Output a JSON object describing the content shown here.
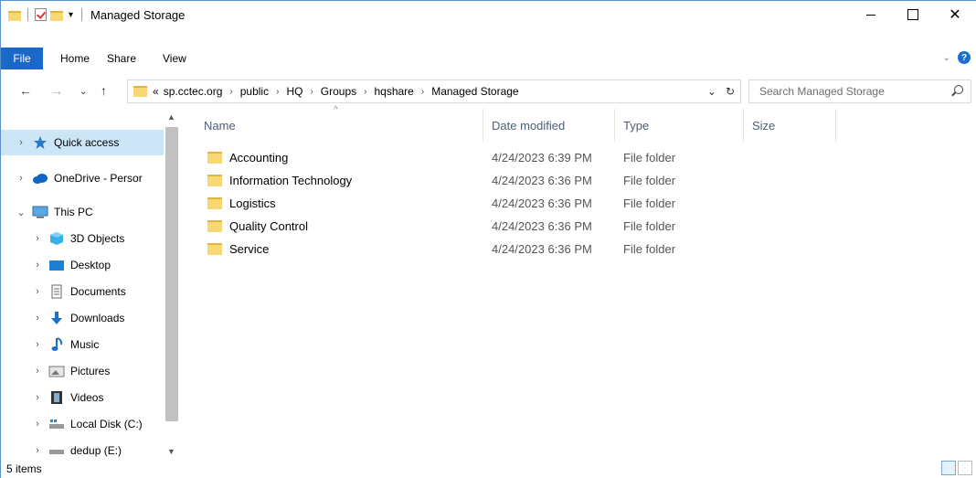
{
  "titlebar": {
    "title": "Managed Storage"
  },
  "ribbon": {
    "tabs": [
      {
        "label": "File"
      },
      {
        "label": "Home"
      },
      {
        "label": "Share"
      },
      {
        "label": "View"
      }
    ],
    "help": "?"
  },
  "address": {
    "prefix": "«",
    "crumbs": [
      "sp.cctec.org",
      "public",
      "HQ",
      "Groups",
      "hqshare",
      "Managed Storage"
    ]
  },
  "search": {
    "placeholder": "Search Managed Storage"
  },
  "navpane": {
    "items": [
      {
        "label": "Quick access",
        "icon": "star-icon",
        "expand": "›",
        "selected": true
      },
      {
        "label": "OneDrive - Persor",
        "icon": "cloud-icon",
        "expand": "›"
      },
      {
        "label": "This PC",
        "icon": "pc-icon",
        "expand": "⌄"
      },
      {
        "label": "3D Objects",
        "icon": "cube-icon",
        "expand": "›"
      },
      {
        "label": "Desktop",
        "icon": "desktop-icon",
        "expand": "›"
      },
      {
        "label": "Documents",
        "icon": "documents-icon",
        "expand": "›"
      },
      {
        "label": "Downloads",
        "icon": "download-icon",
        "expand": "›"
      },
      {
        "label": "Music",
        "icon": "music-icon",
        "expand": "›"
      },
      {
        "label": "Pictures",
        "icon": "pictures-icon",
        "expand": "›"
      },
      {
        "label": "Videos",
        "icon": "videos-icon",
        "expand": "›"
      },
      {
        "label": "Local Disk (C:)",
        "icon": "disk-icon",
        "expand": "›"
      },
      {
        "label": "dedup (E:)",
        "icon": "disk-icon",
        "expand": "›"
      }
    ]
  },
  "columns": {
    "name": "Name",
    "date": "Date modified",
    "type": "Type",
    "size": "Size"
  },
  "files": [
    {
      "name": "Accounting",
      "date": "4/24/2023 6:39 PM",
      "type": "File folder"
    },
    {
      "name": "Information Technology",
      "date": "4/24/2023 6:36 PM",
      "type": "File folder"
    },
    {
      "name": "Logistics",
      "date": "4/24/2023 6:36 PM",
      "type": "File folder"
    },
    {
      "name": "Quality Control",
      "date": "4/24/2023 6:36 PM",
      "type": "File folder"
    },
    {
      "name": "Service",
      "date": "4/24/2023 6:36 PM",
      "type": "File folder"
    }
  ],
  "status": {
    "count": "5 items"
  }
}
